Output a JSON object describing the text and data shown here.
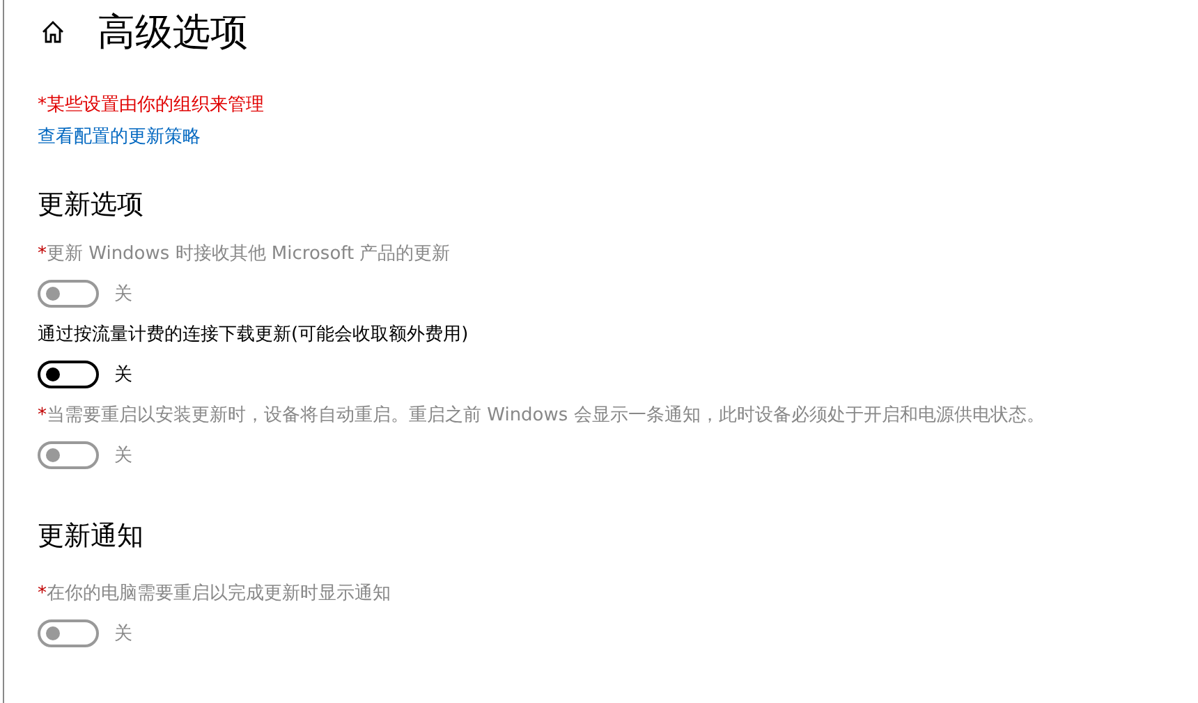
{
  "page": {
    "title": "高级选项"
  },
  "managed_note": "*某些设置由你的组织来管理",
  "policy_link": "查看配置的更新策略",
  "sections": [
    {
      "heading": "更新选项",
      "items": [
        {
          "marker": "*",
          "label": "更新 Windows 时接收其他 Microsoft 产品的更新",
          "on": false,
          "disabled": true,
          "state_label": "关"
        },
        {
          "label": "通过按流量计费的连接下载更新(可能会收取额外费用)",
          "on": false,
          "disabled": false,
          "state_label": "关"
        },
        {
          "marker": "*",
          "label": "当需要重启以安装更新时，设备将自动重启。重启之前 Windows 会显示一条通知，此时设备必须处于开启和电源供电状态。",
          "on": false,
          "disabled": true,
          "state_label": "关"
        }
      ]
    },
    {
      "heading": "更新通知",
      "items": [
        {
          "marker": "*",
          "label": "在你的电脑需要重启以完成更新时显示通知",
          "on": false,
          "disabled": true,
          "state_label": "关"
        }
      ]
    }
  ]
}
